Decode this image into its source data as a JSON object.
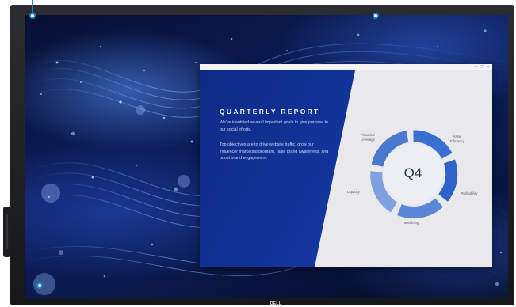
{
  "monitor": {
    "brand": "DELL",
    "screen_background": "abstract blue particle wave wallpaper",
    "callouts": [
      {
        "name": "top-left"
      },
      {
        "name": "top-right"
      },
      {
        "name": "bottom-left"
      }
    ],
    "accent_color": "#1f84c4"
  },
  "window": {
    "controls": [
      "—",
      "❐",
      "✕"
    ]
  },
  "slide": {
    "title": "QUARTERLY REPORT",
    "paragraph_1": "We've identified several important goals to give purpose to our social efforts.",
    "paragraph_2": "Top objectives are to drive website traffic, grow our influencer marketing program, raise brand awareness, and boost brand engagement.",
    "center_label": "Q4",
    "cycle_labels": {
      "financial_leverage": "Financial\nLeverage",
      "asset_efficiency": "Asset\nEfficiency",
      "profitability": "Profitability",
      "marketing": "Marketing",
      "liquidity": "Liquidity"
    },
    "colors": {
      "left_panel": "#13379f",
      "right_panel": "#e9e9ec",
      "cycle_arrows": "#2f63c9"
    }
  }
}
